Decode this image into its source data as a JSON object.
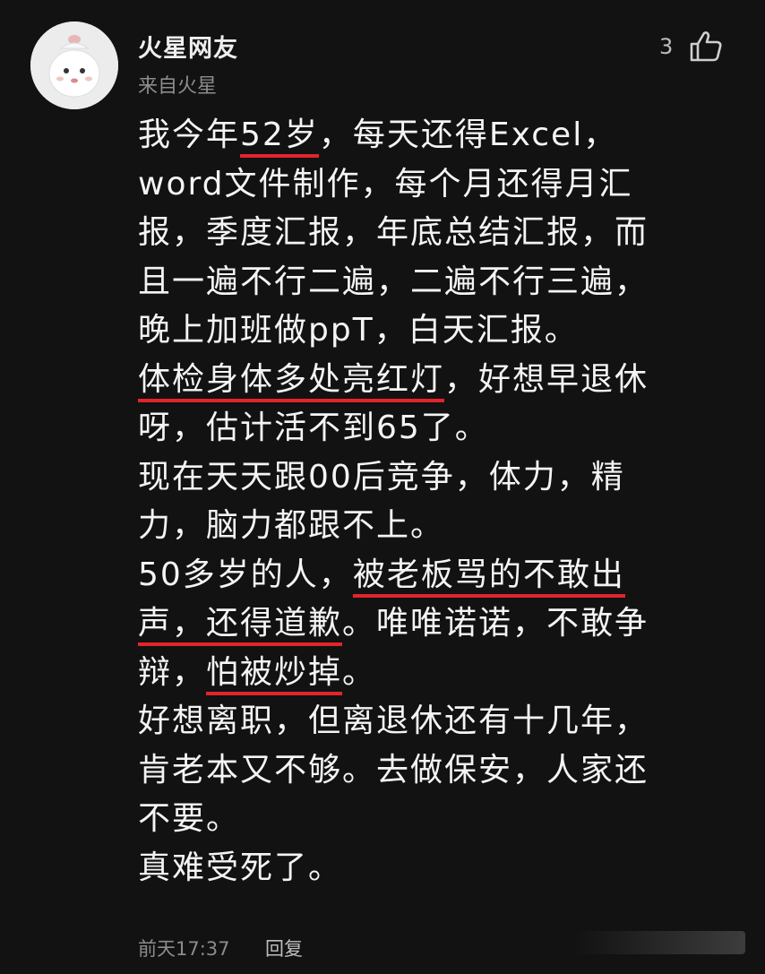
{
  "comment": {
    "username": "火星网友",
    "subtitle": "来自火星",
    "like_count": "3",
    "lines": [
      [
        "我今年",
        "52岁",
        "，每天还得Excel，"
      ],
      [
        "word文件制作，每个月还得月汇"
      ],
      [
        "报，季度汇报，年底总结汇报，而"
      ],
      [
        "且一遍不行二遍，二遍不行三遍，"
      ],
      [
        "晚上加班做ppT，白天汇报。"
      ],
      [
        "体检身体多处亮红灯",
        "，好想早退休"
      ],
      [
        "呀，估计活不到65了。"
      ],
      [
        "现在天天跟00后竞争，体力，精"
      ],
      [
        "力，脑力都跟不上。"
      ],
      [
        "50多岁的人，",
        "被老板骂的不敢出"
      ],
      [
        "声，还得道歉",
        "。唯唯诺诺，不敢争"
      ],
      [
        "辩，",
        "怕被炒掉",
        "。"
      ],
      [
        "好想离职，但离退休还有十几年，"
      ],
      [
        "肯老本又不够。去做保安，人家还"
      ],
      [
        "不要。"
      ],
      [
        "真难受死了。"
      ]
    ],
    "time": "前天17:37",
    "reply_label": "回复"
  },
  "colors": {
    "background": "#121212",
    "text": "#f4f4f4",
    "secondary": "#8c8c8c",
    "highlight_underline": "#e3242b"
  },
  "icons": {
    "avatar": "cartoon-avatar",
    "like": "thumbs-up-icon"
  }
}
